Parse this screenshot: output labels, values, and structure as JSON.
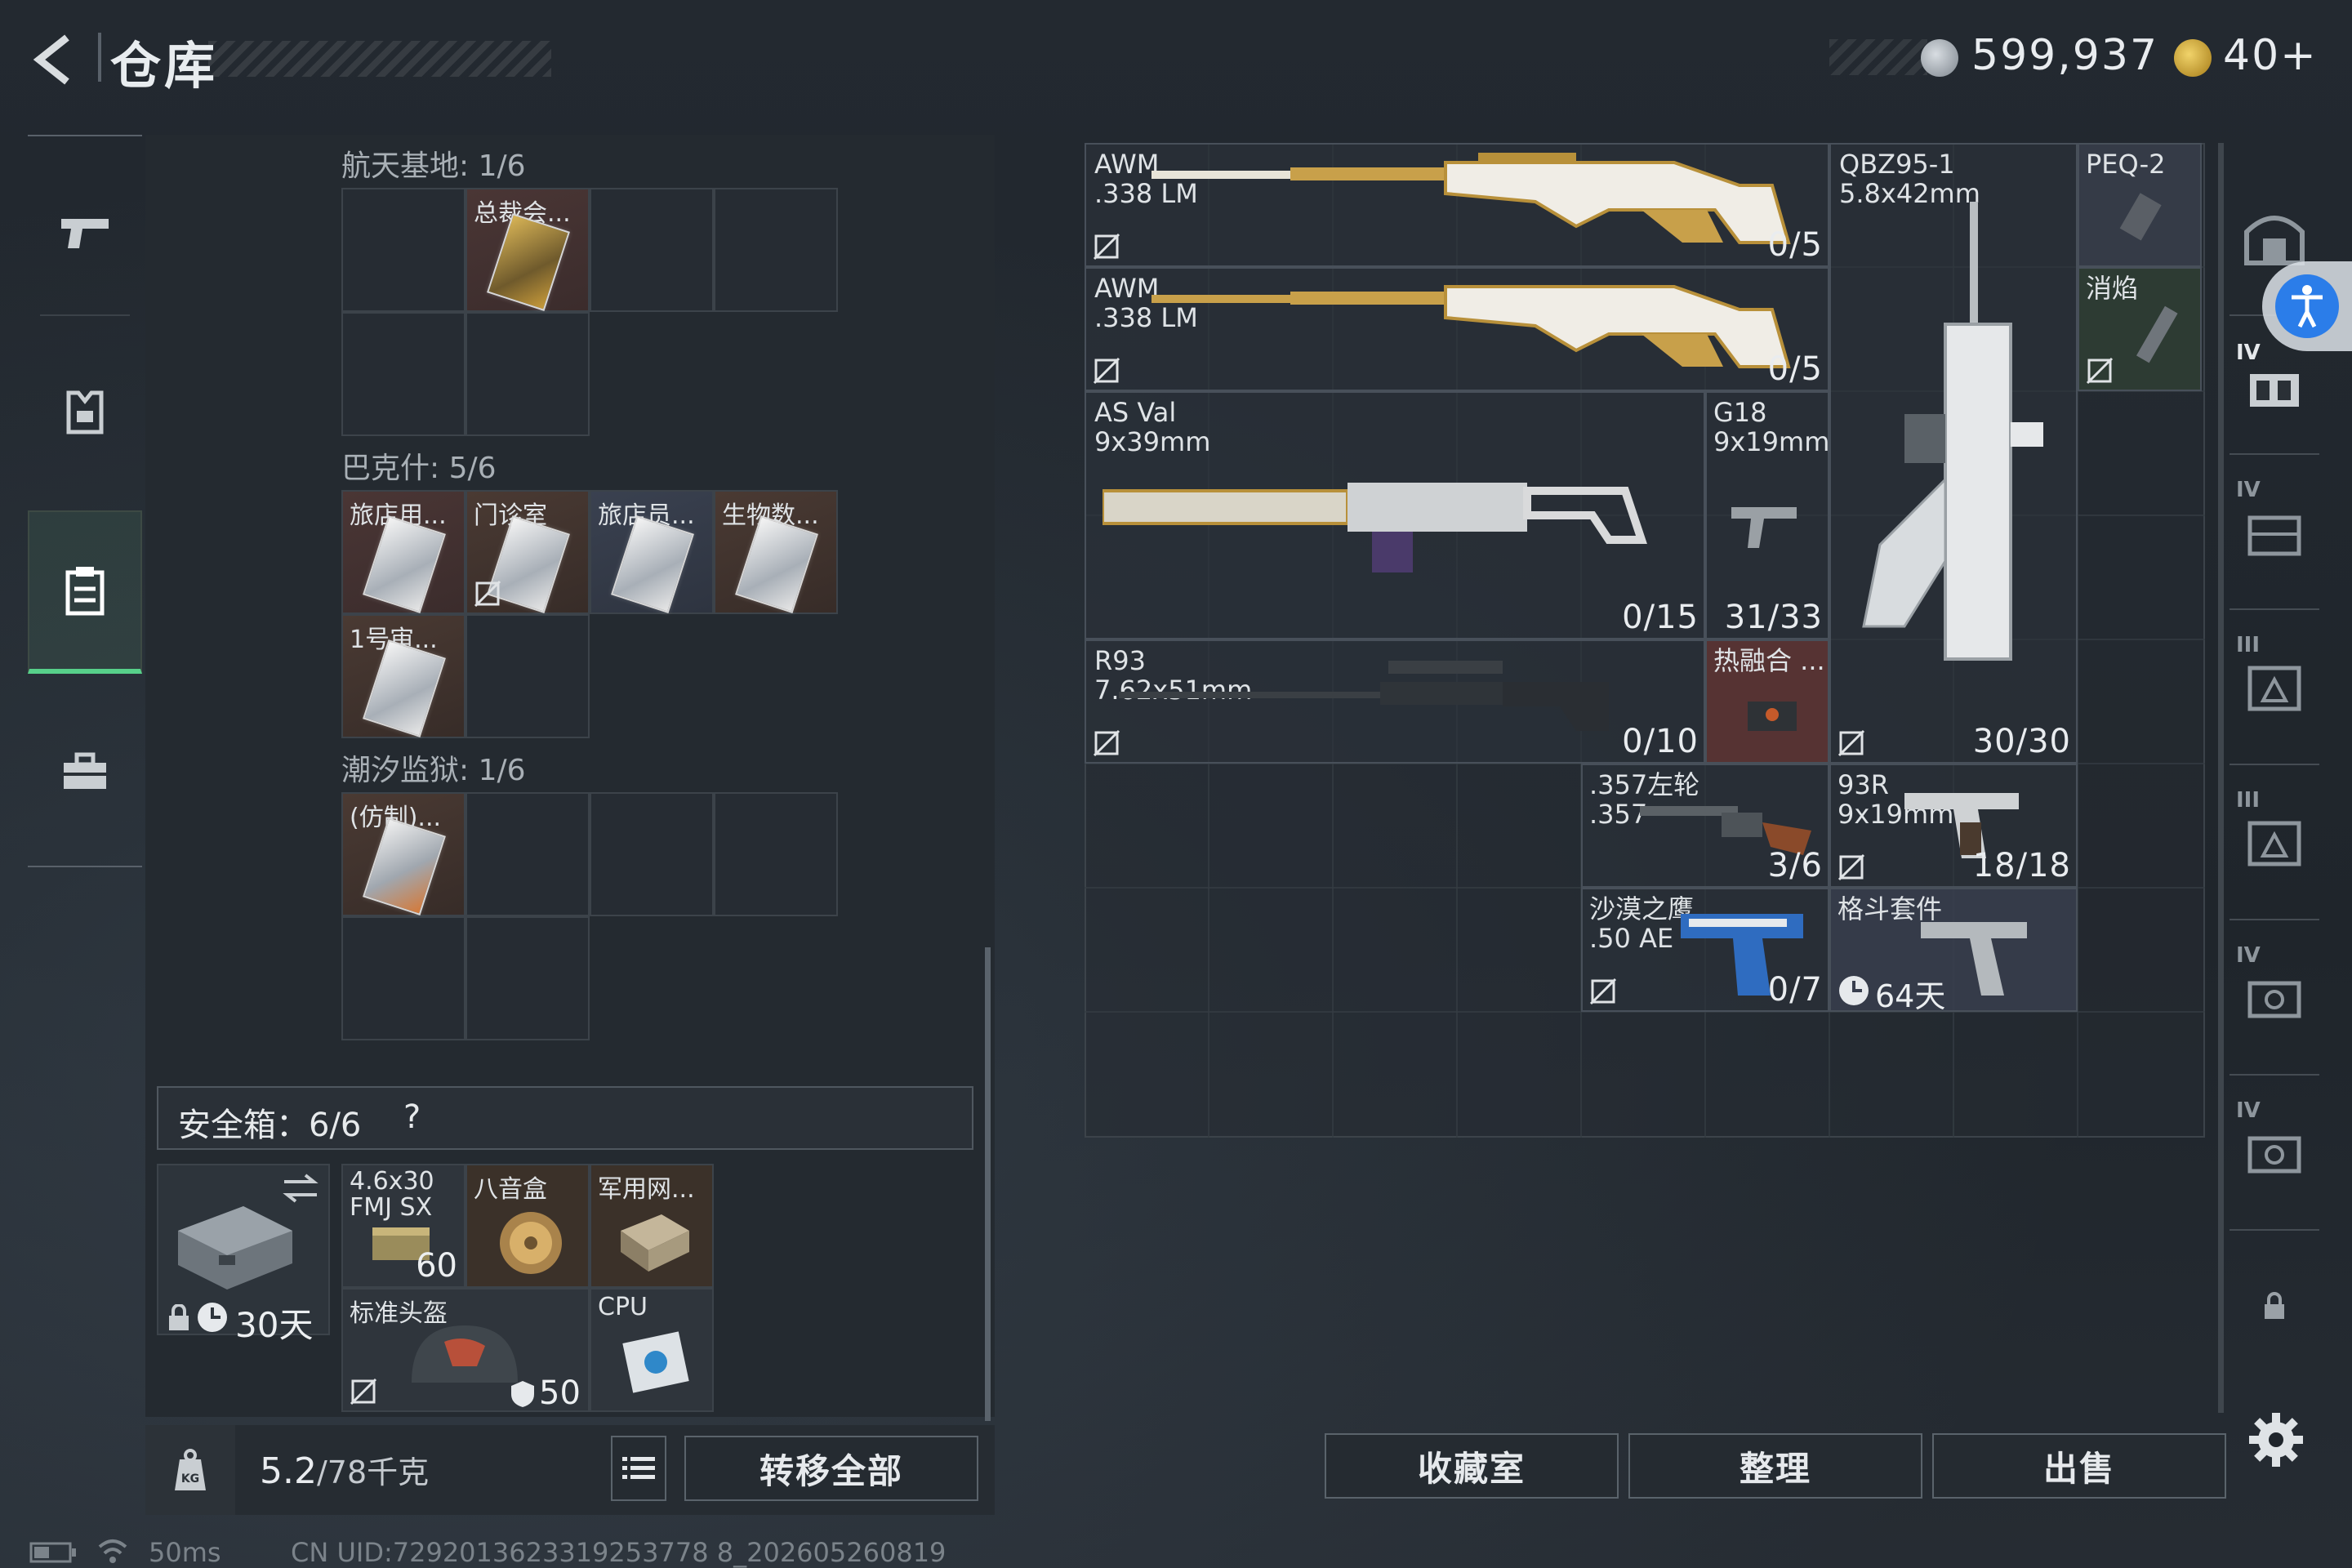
{
  "header": {
    "title": "仓库",
    "currency_1": "599,937",
    "currency_2": "40+"
  },
  "left_nav": {
    "items": [
      "weapon-tab",
      "equipment-tab",
      "storage-tab",
      "case-tab"
    ],
    "active": "storage-tab"
  },
  "keycards": {
    "sections": [
      {
        "title": "航天基地: 1/6",
        "items": [
          {
            "label": "总裁会..."
          }
        ]
      },
      {
        "title": "巴克什: 5/6",
        "items": [
          {
            "label": "旅店用..."
          },
          {
            "label": "门诊室"
          },
          {
            "label": "旅店员..."
          },
          {
            "label": "生物数..."
          },
          {
            "label": "1号审..."
          }
        ]
      },
      {
        "title": "潮汐监狱: 1/6",
        "items": [
          {
            "label": "(仿制)..."
          }
        ]
      }
    ]
  },
  "safe_box": {
    "title": "安全箱：6/6",
    "help": "?",
    "case_timer": "30天",
    "items": [
      {
        "label": "4.6x30 FMJ SX",
        "count": "60"
      },
      {
        "label": "八音盒",
        "count": ""
      },
      {
        "label": "军用网...",
        "count": ""
      },
      {
        "label": "标准头盔",
        "count": "50"
      },
      {
        "label": "CPU",
        "count": ""
      }
    ]
  },
  "weight": {
    "value": "5.2",
    "capacity": "/78千克",
    "unit_icon": "KG"
  },
  "buttons": {
    "transfer_all": "转移全部",
    "collection": "收藏室",
    "sort": "整理",
    "sell": "出售"
  },
  "weapons": [
    {
      "name": "AWM",
      "caliber": ".338 LM",
      "ammo": "0/5"
    },
    {
      "name": "AWM",
      "caliber": ".338 LM",
      "ammo": "0/5"
    },
    {
      "name": "QBZ95-1",
      "caliber": "5.8x42mm",
      "ammo": "30/30"
    },
    {
      "name": "PEQ-2",
      "caliber": "",
      "ammo": ""
    },
    {
      "name": "消焰",
      "caliber": "",
      "ammo": ""
    },
    {
      "name": "AS Val",
      "caliber": "9x39mm",
      "ammo": "0/15"
    },
    {
      "name": "G18",
      "caliber": "9x19mm",
      "ammo": "31/33"
    },
    {
      "name": "R93",
      "caliber": "7.62x51mm",
      "ammo": "0/10"
    },
    {
      "name": "热融合 ...",
      "caliber": "",
      "ammo": ""
    },
    {
      "name": ".357左轮",
      "caliber": ".357",
      "ammo": "3/6"
    },
    {
      "name": "93R",
      "caliber": "9x19mm",
      "ammo": "18/18"
    },
    {
      "name": "沙漠之鹰",
      "caliber": ".50 AE",
      "ammo": "0/7"
    },
    {
      "name": "格斗套件",
      "caliber": "",
      "ammo": "",
      "timer": "64天"
    }
  ],
  "right_nav": {
    "tiers": [
      "IV",
      "IV",
      "III",
      "III",
      "IV",
      "IV"
    ]
  },
  "status_bar": {
    "ping": "50ms",
    "uid": "CN UID:7292013623319253778 8_202605260819"
  },
  "colors": {
    "accent_green": "#57d08a",
    "accessibility_blue": "#2b7de9"
  }
}
